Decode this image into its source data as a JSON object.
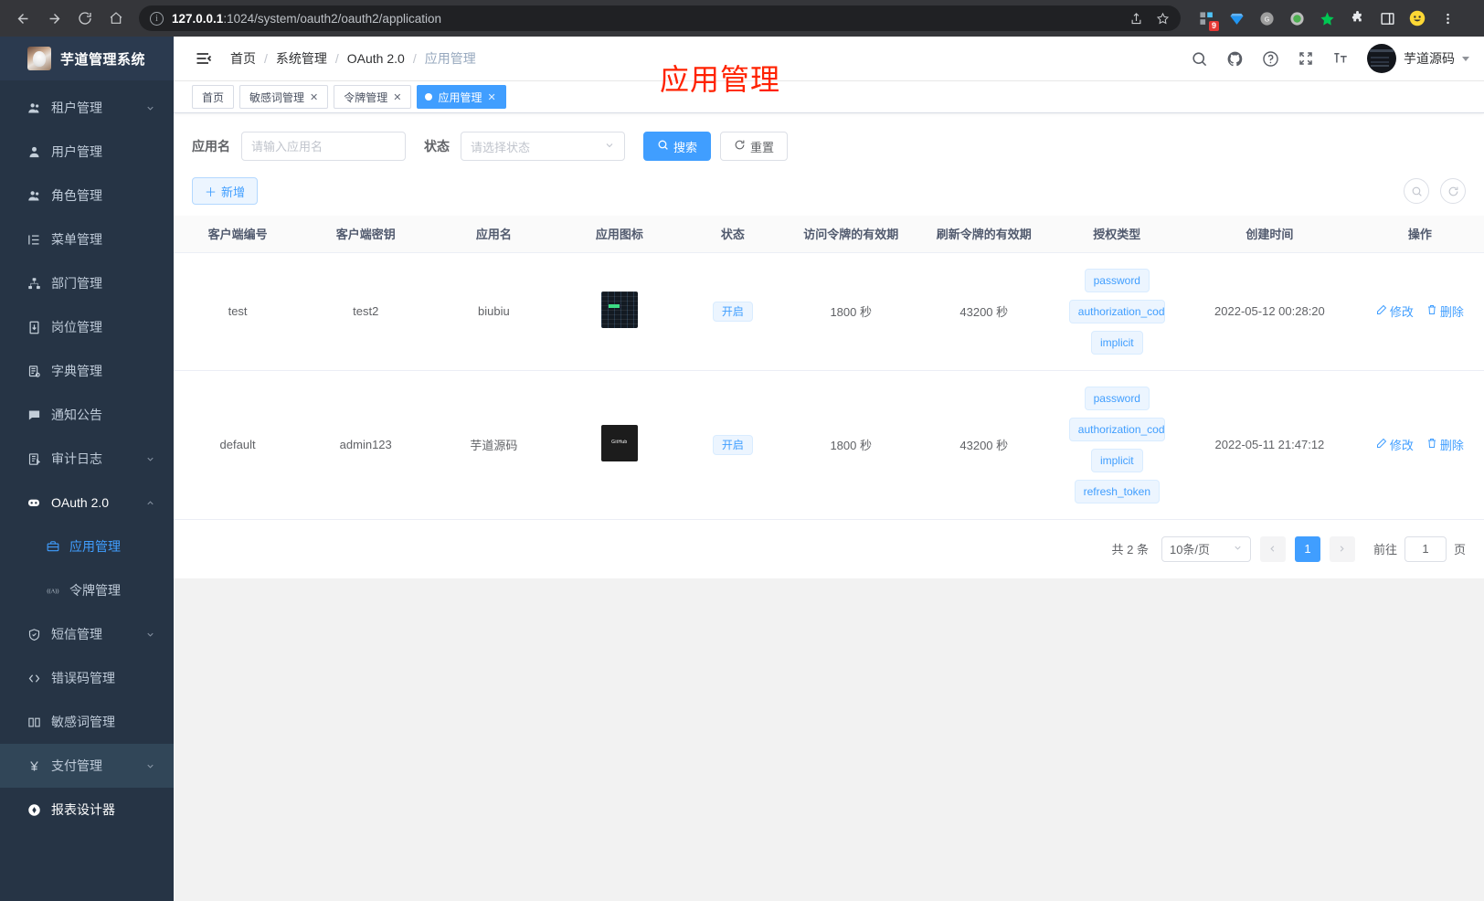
{
  "browser": {
    "url_host": "127.0.0.1",
    "url_path": ":1024/system/oauth2/oauth2/application",
    "back_icon": "back-arrow-icon",
    "forward_icon": "forward-arrow-icon",
    "reload_icon": "reload-icon",
    "home_icon": "home-icon",
    "share_icon": "share-icon",
    "bookmark_icon": "star-icon",
    "extension_badge": "9"
  },
  "sidebar": {
    "logo_title": "芋道管理系统",
    "items": [
      {
        "label": "租户管理",
        "icon": "users-icon",
        "arrow": "chevron-down",
        "level": 1
      },
      {
        "label": "用户管理",
        "icon": "user-icon",
        "arrow": "",
        "level": 1
      },
      {
        "label": "角色管理",
        "icon": "users-icon",
        "arrow": "",
        "level": 1
      },
      {
        "label": "菜单管理",
        "icon": "menu-list-icon",
        "arrow": "",
        "level": 1
      },
      {
        "label": "部门管理",
        "icon": "sitemap-icon",
        "arrow": "",
        "level": 1
      },
      {
        "label": "岗位管理",
        "icon": "badge-icon",
        "arrow": "",
        "level": 1
      },
      {
        "label": "字典管理",
        "icon": "book-icon",
        "arrow": "",
        "level": 1
      },
      {
        "label": "通知公告",
        "icon": "comment-icon",
        "arrow": "",
        "level": 1
      },
      {
        "label": "审计日志",
        "icon": "edit-note-icon",
        "arrow": "chevron-down",
        "level": 1
      },
      {
        "label": "OAuth 2.0",
        "icon": "robot-icon",
        "arrow": "chevron-up",
        "level": 1
      },
      {
        "label": "应用管理",
        "icon": "briefcase-icon",
        "arrow": "",
        "level": 2,
        "active": true
      },
      {
        "label": "令牌管理",
        "icon": "token-icon",
        "arrow": "",
        "level": 2
      },
      {
        "label": "短信管理",
        "icon": "shield-icon",
        "arrow": "chevron-down",
        "level": 1
      },
      {
        "label": "错误码管理",
        "icon": "code-icon",
        "arrow": "",
        "level": 1
      },
      {
        "label": "敏感词管理",
        "icon": "open-book-icon",
        "arrow": "",
        "level": 1
      },
      {
        "label": "支付管理",
        "icon": "yen-icon",
        "arrow": "chevron-down",
        "level": 1,
        "highlight": true
      },
      {
        "label": "报表设计器",
        "icon": "gear-icon",
        "arrow": "",
        "level": 1,
        "white": true
      }
    ]
  },
  "topbar": {
    "hamburger_icon": "hamburger-icon",
    "breadcrumb": [
      "首页",
      "系统管理",
      "OAuth 2.0",
      "应用管理"
    ],
    "icons": [
      "search-icon",
      "github-icon",
      "help-icon",
      "fullscreen-icon",
      "font-size-icon"
    ],
    "username": "芋道源码"
  },
  "tabs": [
    {
      "label": "首页",
      "closable": false,
      "active": false
    },
    {
      "label": "敏感词管理",
      "closable": true,
      "active": false
    },
    {
      "label": "令牌管理",
      "closable": true,
      "active": false
    },
    {
      "label": "应用管理",
      "closable": true,
      "active": true
    }
  ],
  "watermark": "应用管理",
  "filter": {
    "name_label": "应用名",
    "name_placeholder": "请输入应用名",
    "name_value": "",
    "status_label": "状态",
    "status_placeholder": "请选择状态",
    "search_label": "搜索",
    "search_icon": "search-icon",
    "reset_label": "重置",
    "reset_icon": "refresh-icon",
    "add_label": "新增",
    "add_icon": "plus-icon",
    "toolbar_icons": [
      "search-circle-icon",
      "refresh-circle-icon"
    ]
  },
  "table": {
    "columns": [
      "客户端编号",
      "客户端密钥",
      "应用名",
      "应用图标",
      "状态",
      "访问令牌的有效期",
      "刷新令牌的有效期",
      "授权类型",
      "创建时间",
      "操作"
    ],
    "rows": [
      {
        "client_id": "test",
        "client_secret": "test2",
        "app_name": "biubiu",
        "app_icon": "app-icon-terminal",
        "status": "开启",
        "access_token_validity": "1800 秒",
        "refresh_token_validity": "43200 秒",
        "grant_types": [
          "password",
          "authorization_code",
          "implicit"
        ],
        "create_time": "2022-05-12 00:28:20",
        "edit_label": "修改",
        "delete_label": "删除"
      },
      {
        "client_id": "default",
        "client_secret": "admin123",
        "app_name": "芋道源码",
        "app_icon": "app-icon-github",
        "status": "开启",
        "access_token_validity": "1800 秒",
        "refresh_token_validity": "43200 秒",
        "grant_types": [
          "password",
          "authorization_code",
          "implicit",
          "refresh_token"
        ],
        "create_time": "2022-05-11 21:47:12",
        "edit_label": "修改",
        "delete_label": "删除"
      }
    ]
  },
  "pagination": {
    "total_label": "共 2 条",
    "page_size": "10条/页",
    "prev_icon": "chevron-left-icon",
    "next_icon": "chevron-right-icon",
    "current_page": "1",
    "jump_label": "前往",
    "jump_value": "1",
    "page_unit": "页"
  },
  "colors": {
    "accent": "#409eff",
    "sidebar_bg": "#263445",
    "watermark": "#ff2200",
    "tag_bg": "#ecf5ff"
  }
}
